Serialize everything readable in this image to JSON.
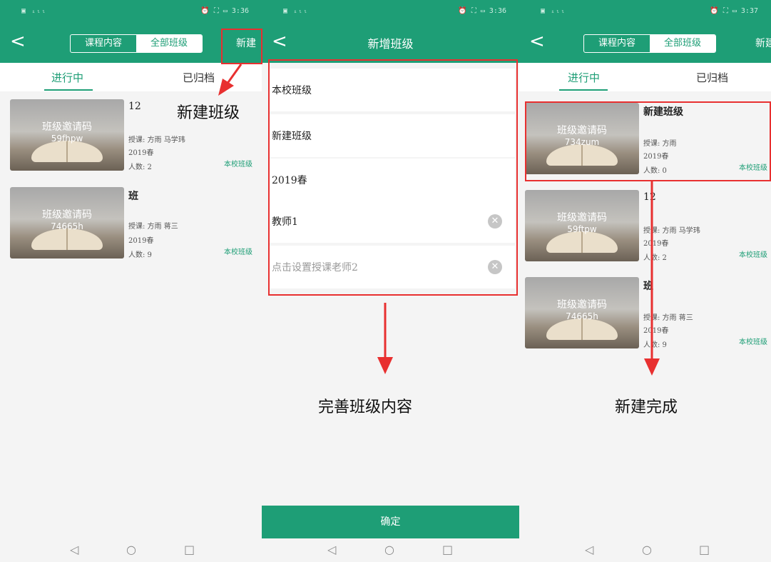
{
  "status": {
    "left": "▣ ᵢₗₗ",
    "right_p1": "⏰ ⛶ ▭ 3:36",
    "right_p2": "⏰ ⛶ ▭ 3:36",
    "right_p3": "⏰ ⛶ ▭ 3:37"
  },
  "screen1": {
    "back": "<",
    "seg_course": "课程内容",
    "seg_all": "全部班级",
    "new_button": "新建",
    "tab_active": "进行中",
    "tab_archived": "已归档",
    "classes": [
      {
        "name": "12",
        "thumb_title": "班级邀请码",
        "code": "59fhpw",
        "teacher": "授课: 方雨 马学玮",
        "term": "2019春",
        "count": "人数: 2",
        "tag": "本校班级"
      },
      {
        "name": "班",
        "thumb_title": "班级邀请码",
        "code": "74665h",
        "teacher": "授课: 方雨 蒋三",
        "term": "2019春",
        "count": "人数: 9",
        "tag": "本校班级"
      }
    ]
  },
  "screen2": {
    "back": "<",
    "title": "新增班级",
    "fields": [
      "本校班级",
      "新建班级",
      "2019春",
      "教师1"
    ],
    "teacher2_placeholder": "点击设置授课老师2",
    "confirm": "确定"
  },
  "screen3": {
    "back": "<",
    "seg_course": "课程内容",
    "seg_all": "全部班级",
    "new_button": "新建",
    "tab_active": "进行中",
    "tab_archived": "已归档",
    "classes": [
      {
        "name": "新建班级",
        "thumb_title": "班级邀请码",
        "code": "734zum",
        "teacher": "授课: 方雨",
        "term": "2019春",
        "count": "人数: 0",
        "tag": "本校班级"
      },
      {
        "name": "12",
        "thumb_title": "班级邀请码",
        "code": "59ftpw",
        "teacher": "授课: 方雨 马学玮",
        "term": "2019春",
        "count": "人数: 2",
        "tag": "本校班级"
      },
      {
        "name": "班",
        "thumb_title": "班级邀请码",
        "code": "74665h",
        "teacher": "授课: 方雨 蒋三",
        "term": "2019春",
        "count": "人数: 9",
        "tag": "本校班级"
      }
    ]
  },
  "nav": {
    "back": "◁",
    "home": "○",
    "recent": "□"
  },
  "annotations": {
    "new_class": "新建班级",
    "complete_content": "完善班级内容",
    "done": "新建完成"
  },
  "colors": {
    "brand_green": "#1e9e76",
    "annotation_red": "#e83030"
  }
}
